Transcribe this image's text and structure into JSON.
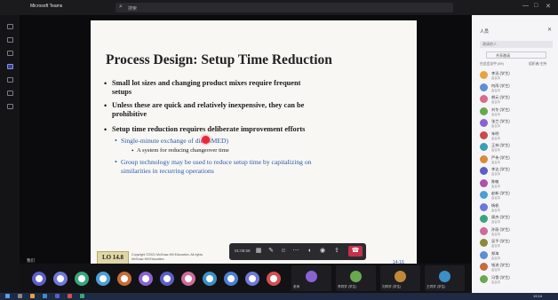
{
  "app": {
    "name": "Microsoft Teams",
    "search_text": "搜索"
  },
  "window_controls": [
    "—",
    "□",
    "✕"
  ],
  "slide": {
    "title": "Process Design: Setup Time Reduction",
    "bullets": [
      "Small lot sizes and changing product mixes require frequent",
      "setups",
      "Unless these are quick and relatively inexpensive, they can be",
      "prohibitive",
      "Setup time reduction requires deliberate improvement efforts"
    ],
    "sub_bullets": [
      "Single-minute exchange of die (SMED)",
      "Group technology may be used to reduce setup time by capitalizing on",
      "similarities in recurring operations"
    ],
    "sub_sub_bullet": "A system for reducing changeover time",
    "lo_label": "LO 14.8",
    "copyright_line1": "Copyright ©2021 McGraw-Hill Education. All rights",
    "copyright_line2": "McGraw-Hill Education.",
    "copyright_tail": "or consent of",
    "slide_number": "14-16"
  },
  "controls": {
    "timer": "01:08:58"
  },
  "presenter_name": "我们",
  "participants_strip": {
    "avatar_colors": [
      "#5b5fc7",
      "#6f78d8",
      "#3aa57a",
      "#4c9fd6",
      "#c66b3a",
      "#8a63d2",
      "#5b5fc7",
      "#d06a9a",
      "#3a8fc6",
      "#4b7fd4",
      "#6f78d8",
      "#d35050"
    ],
    "tiles": [
      {
        "name": "老师",
        "color": "#8a63d2"
      },
      {
        "name": "李同学 (学生)",
        "color": "#6aa84f"
      },
      {
        "name": "刘同学 (学生)",
        "color": "#c0883a"
      },
      {
        "name": "王同学 (学生)",
        "color": "#3a8fc6"
      }
    ]
  },
  "panel": {
    "title": "人员",
    "close": "✕",
    "invite_placeholder": "邀请他人",
    "share_label": "共享邀请",
    "header_left": "在此会议中 (59)",
    "header_right": "组织者/主持",
    "people": [
      {
        "name": "李迅 (学生)",
        "sub": "会议中",
        "color": "#e8a33a"
      },
      {
        "name": "何雨 (学生)",
        "sub": "会议中",
        "color": "#5b8fd6"
      },
      {
        "name": "胡元 (学生)",
        "sub": "会议中",
        "color": "#d96a8a"
      },
      {
        "name": "刘冬 (学生)",
        "sub": "会议中",
        "color": "#6aa84f"
      },
      {
        "name": "张兰 (学生)",
        "sub": "会议中",
        "color": "#8a63d2"
      },
      {
        "name": "朱明",
        "sub": "会议中",
        "color": "#c94b4b"
      },
      {
        "name": "王林 (学生)",
        "sub": "会议中",
        "color": "#3a9fb2"
      },
      {
        "name": "严伟 (学生)",
        "sub": "会议中",
        "color": "#d98a3a"
      },
      {
        "name": "李达 (学生)",
        "sub": "会议中",
        "color": "#5b5fc7"
      },
      {
        "name": "陈敏",
        "sub": "会议中",
        "color": "#b04fb0"
      },
      {
        "name": "赵新 (学生)",
        "sub": "会议中",
        "color": "#4c9fd6"
      },
      {
        "name": "杨帆",
        "sub": "会议中",
        "color": "#6f78d8"
      },
      {
        "name": "周杰 (学生)",
        "sub": "会议中",
        "color": "#3aa57a"
      },
      {
        "name": "孙丽 (学生)",
        "sub": "会议中",
        "color": "#d06a9a"
      },
      {
        "name": "吴平 (学生)",
        "sub": "会议中",
        "color": "#8a8a3a"
      },
      {
        "name": "郑海",
        "sub": "会议中",
        "color": "#5b8fd6"
      },
      {
        "name": "钱进 (学生)",
        "sub": "会议中",
        "color": "#c66b3a"
      },
      {
        "name": "冯雪 (学生)",
        "sub": "会议中",
        "color": "#6aa84f"
      }
    ]
  },
  "taskbar": {
    "clock": "19:16"
  }
}
